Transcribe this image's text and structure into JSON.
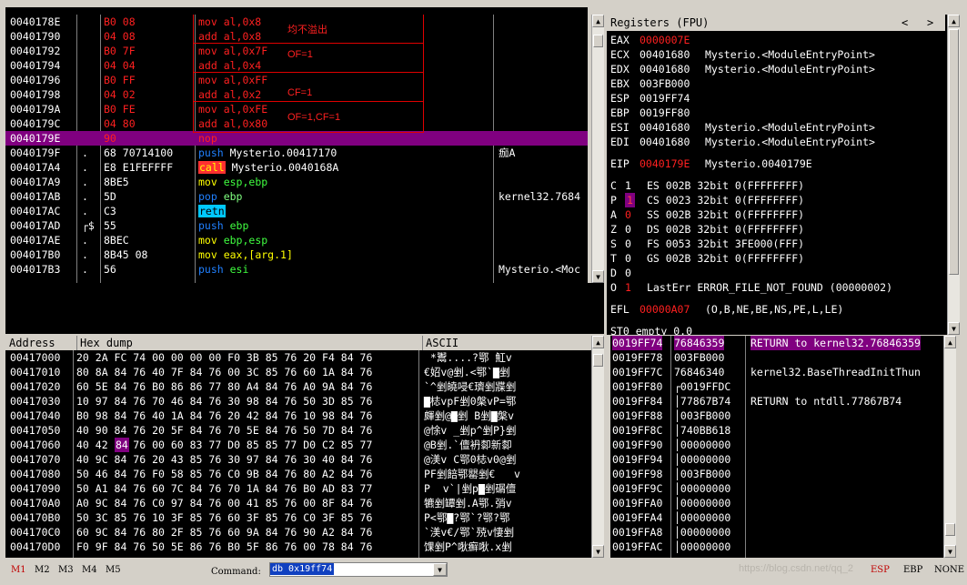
{
  "disasm": {
    "rows": [
      {
        "addr": "0040178E",
        "mark": "",
        "hex": "B0 08",
        "ins": "mov al,0x8",
        "style": "red"
      },
      {
        "addr": "00401790",
        "mark": "",
        "hex": "04 08",
        "ins": "add al,0x8",
        "style": "red"
      },
      {
        "addr": "00401792",
        "mark": "",
        "hex": "B0 7F",
        "ins": "mov al,0x7F",
        "style": "red"
      },
      {
        "addr": "00401794",
        "mark": "",
        "hex": "04 04",
        "ins": "add al,0x4",
        "style": "red"
      },
      {
        "addr": "00401796",
        "mark": "",
        "hex": "B0 FF",
        "ins": "mov al,0xFF",
        "style": "red"
      },
      {
        "addr": "00401798",
        "mark": "",
        "hex": "04 02",
        "ins": "add al,0x2",
        "style": "red"
      },
      {
        "addr": "0040179A",
        "mark": "",
        "hex": "B0 FE",
        "ins": "mov al,0xFE",
        "style": "red"
      },
      {
        "addr": "0040179C",
        "mark": "",
        "hex": "04 80",
        "ins": "add al,0x80",
        "style": "red"
      },
      {
        "addr": "0040179E",
        "mark": "",
        "hex": "90",
        "ins": "nop",
        "style": "sel"
      },
      {
        "addr": "0040179F",
        "mark": ".",
        "hex": "68 70714100",
        "ins_kw": "push",
        "ins_rest": " Mysterio.00417170",
        "kwstyle": "blue",
        "reststyle": "white",
        "cmt": "痂A"
      },
      {
        "addr": "004017A4",
        "mark": ".",
        "hex": "E8 E1FEFFFF",
        "ins_kw": "call",
        "ins_rest": " Mysterio.0040168A",
        "kwstyle": "call",
        "reststyle": "white",
        "cmt": ""
      },
      {
        "addr": "004017A9",
        "mark": ".",
        "hex": "8BE5",
        "ins_kw": "mov",
        "ins_rest": " esp,ebp",
        "kwstyle": "yellow",
        "reststyle": "green",
        "cmt": ""
      },
      {
        "addr": "004017AB",
        "mark": ".",
        "hex": "5D",
        "ins_kw": "pop",
        "ins_rest": " ebp",
        "kwstyle": "blue",
        "reststyle": "lgreen",
        "cmt": "kernel32.7684"
      },
      {
        "addr": "004017AC",
        "mark": ".",
        "hex": "C3",
        "ins_kw": "retn",
        "ins_rest": "",
        "kwstyle": "retn",
        "reststyle": "white",
        "cmt": ""
      },
      {
        "addr": "004017AD",
        "mark": "┌$",
        "hex": "55",
        "ins_kw": "push",
        "ins_rest": " ebp",
        "kwstyle": "blue",
        "reststyle": "green",
        "cmt": ""
      },
      {
        "addr": "004017AE",
        "mark": ".",
        "hex": "8BEC",
        "ins_kw": "mov",
        "ins_rest": " ebp,esp",
        "kwstyle": "yellow",
        "reststyle": "green",
        "cmt": ""
      },
      {
        "addr": "004017B0",
        "mark": ".",
        "hex": "8B45 08",
        "ins_kw": "mov",
        "ins_rest": " eax,[arg.1]",
        "kwstyle": "yellow",
        "reststyle": "yellow",
        "cmt": ""
      },
      {
        "addr": "004017B3",
        "mark": ".",
        "hex": "56",
        "ins_kw": "push",
        "ins_rest": " esi",
        "kwstyle": "blue",
        "reststyle": "green",
        "cmt": "Mysterio.<Moc"
      }
    ],
    "annotations": [
      "均不溢出",
      "OF=1",
      "CF=1",
      "OF=1,CF=1"
    ]
  },
  "registers": {
    "title": "Registers (FPU)",
    "nav": [
      "<",
      ">"
    ],
    "gp": [
      {
        "name": "EAX",
        "val": "0000007E",
        "changed": true,
        "desc": ""
      },
      {
        "name": "ECX",
        "val": "00401680",
        "changed": false,
        "desc": "Mysterio.<ModuleEntryPoint>"
      },
      {
        "name": "EDX",
        "val": "00401680",
        "changed": false,
        "desc": "Mysterio.<ModuleEntryPoint>"
      },
      {
        "name": "EBX",
        "val": "003FB000",
        "changed": false,
        "desc": ""
      },
      {
        "name": "ESP",
        "val": "0019FF74",
        "changed": false,
        "desc": ""
      },
      {
        "name": "EBP",
        "val": "0019FF80",
        "changed": false,
        "desc": ""
      },
      {
        "name": "ESI",
        "val": "00401680",
        "changed": false,
        "desc": "Mysterio.<ModuleEntryPoint>"
      },
      {
        "name": "EDI",
        "val": "00401680",
        "changed": false,
        "desc": "Mysterio.<ModuleEntryPoint>"
      }
    ],
    "eip": {
      "name": "EIP",
      "val": "0040179E",
      "desc": "Mysterio.0040179E"
    },
    "flags": [
      {
        "f": "C",
        "v": "1",
        "changed": false,
        "seg": "ES 002B 32bit 0(FFFFFFFF)"
      },
      {
        "f": "P",
        "v": "1",
        "changed": true,
        "seg": "CS 0023 32bit 0(FFFFFFFF)"
      },
      {
        "f": "A",
        "v": "0",
        "changed": true,
        "seg": "SS 002B 32bit 0(FFFFFFFF)"
      },
      {
        "f": "Z",
        "v": "0",
        "changed": false,
        "seg": "DS 002B 32bit 0(FFFFFFFF)"
      },
      {
        "f": "S",
        "v": "0",
        "changed": false,
        "seg": "FS 0053 32bit 3FE000(FFF)"
      },
      {
        "f": "T",
        "v": "0",
        "changed": false,
        "seg": "GS 002B 32bit 0(FFFFFFFF)"
      },
      {
        "f": "D",
        "v": "0",
        "changed": false,
        "seg": ""
      },
      {
        "f": "O",
        "v": "1",
        "changed": true,
        "seg": "LastErr ERROR_FILE_NOT_FOUND (00000002)"
      }
    ],
    "efl": {
      "name": "EFL",
      "val": "00000A07",
      "desc": "(O,B,NE,BE,NS,PE,L,LE)"
    },
    "st0": "ST0 empty 0.0"
  },
  "dump": {
    "headers": {
      "address": "Address",
      "hex": "Hex dump",
      "ascii": "ASCII"
    },
    "rows": [
      {
        "addr": "00417000",
        "hex": "20 2A FC 74 00 00 00 00 F0 3B 85 76 20 F4 84 76",
        "ascii": " *鬻....?鄂 魟v"
      },
      {
        "addr": "00417010",
        "hex": "80 8A 84 76 40 7F 84 76 00 3C 85 76 60 1A 84 76",
        "ascii": "€妱v@剉.<鄂`▇剉"
      },
      {
        "addr": "00417020",
        "hex": "60 5E 84 76 B0 86 86 77 80 A4 84 76 A0 9A 84 76",
        "ascii": "`^剉皢唚€璾剉牃剉"
      },
      {
        "addr": "00417030",
        "hex": "10 97 84 76 70 46 84 76 30 98 84 76 50 3D 85 76",
        "ascii": "▇梽vpF剉0槃vP=鄂"
      },
      {
        "addr": "00417040",
        "hex": "B0 98 84 76 40 1A 84 76 20 42 84 76 10 98 84 76",
        "ascii": "皹剉@▇剉 B剉▇槃v"
      },
      {
        "addr": "00417050",
        "hex": "40 90 84 76 20 5F 84 76 70 5E 84 76 50 7D 84 76",
        "ascii": "@悇v _剉p^剉P}剉"
      },
      {
        "addr": "00417060",
        "hex": "40 42 84 76 00 60 83 77 D0 85 85 77 D0 C2 85 77",
        "ascii": "@B剉.`儃袇厀新厀"
      },
      {
        "addr": "00417070",
        "hex": "40 9C 84 76 20 43 85 76 30 97 84 76 30 40 84 76",
        "ascii": "@渼v C鄂0梽v0@剉"
      },
      {
        "addr": "00417080",
        "hex": "50 46 84 76 F0 58 85 76 C0 9B 84 76 80 A2 84 76",
        "ascii": "PF剉餢鄂罌剉€   v"
      },
      {
        "addr": "00417090",
        "hex": "50 A1 84 76 60 7C 84 76 70 1A 84 76 B0 AD 83 77",
        "ascii": "P  v`|剉p▇剉碿儃"
      },
      {
        "addr": "004170A0",
        "hex": "A0 9C 84 76 C0 97 84 76 00 41 85 76 00 8F 84 76",
        "ascii": "犥剉罈剉.A鄂.弰v"
      },
      {
        "addr": "004170B0",
        "hex": "50 3C 85 76 10 3F 85 76 60 3F 85 76 C0 3F 85 76",
        "ascii": "P<鄂▇?鄂`?鄂?鄂"
      },
      {
        "addr": "004170C0",
        "hex": "60 9C 84 76 80 2F 85 76 60 9A 84 76 90 A2 84 76",
        "ascii": "`渼v€/鄂`殑v悽剉"
      },
      {
        "addr": "004170D0",
        "hex": "F0 9F 84 76 50 5E 86 76 B0 5F 86 76 00 78 84 76",
        "ascii": "馃剉P^唙癬唙.x剉"
      }
    ],
    "highlight": {
      "row": 6,
      "byte": 2
    }
  },
  "stack": {
    "rows": [
      {
        "addr": "0019FF74",
        "val": "76846359",
        "cmt": "RETURN to kernel32.76846359",
        "sel": true
      },
      {
        "addr": "0019FF78",
        "val": "003FB000",
        "cmt": ""
      },
      {
        "addr": "0019FF7C",
        "val": "76846340",
        "cmt": "kernel32.BaseThreadInitThun"
      },
      {
        "addr": "0019FF80",
        "val": "┌0019FFDC",
        "cmt": ""
      },
      {
        "addr": "0019FF84",
        "val": "│77867B74",
        "cmt": "RETURN to ntdll.77867B74"
      },
      {
        "addr": "0019FF88",
        "val": "│003FB000",
        "cmt": ""
      },
      {
        "addr": "0019FF8C",
        "val": "│740BB618",
        "cmt": ""
      },
      {
        "addr": "0019FF90",
        "val": "│00000000",
        "cmt": ""
      },
      {
        "addr": "0019FF94",
        "val": "│00000000",
        "cmt": ""
      },
      {
        "addr": "0019FF98",
        "val": "│003FB000",
        "cmt": ""
      },
      {
        "addr": "0019FF9C",
        "val": "│00000000",
        "cmt": ""
      },
      {
        "addr": "0019FFA0",
        "val": "│00000000",
        "cmt": ""
      },
      {
        "addr": "0019FFA4",
        "val": "│00000000",
        "cmt": ""
      },
      {
        "addr": "0019FFA8",
        "val": "│00000000",
        "cmt": ""
      },
      {
        "addr": "0019FFAC",
        "val": "│00000000",
        "cmt": ""
      }
    ]
  },
  "bottom": {
    "mbuttons": [
      "M1",
      "M2",
      "M3",
      "M4",
      "M5"
    ],
    "command_label": "Command:",
    "command_value": "db 0x19ff74",
    "status": [
      "ESP",
      "EBP",
      "NONE"
    ],
    "watermark": "https://blog.csdn.net/qq_2"
  },
  "colors": {
    "bg": "#000000",
    "selected": "#800080",
    "changed": "#ff2020",
    "annotation_box": "#e00000"
  }
}
